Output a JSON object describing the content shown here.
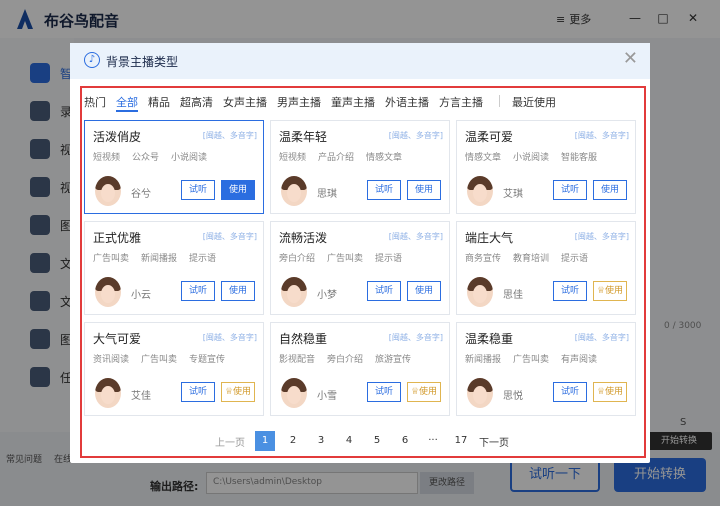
{
  "app": {
    "name": "布谷鸟配音",
    "more_label": "更多",
    "window_controls": [
      "—",
      "□",
      "✕"
    ],
    "sidebar_labels": [
      "智",
      "录",
      "视",
      "视",
      "图",
      "文",
      "文",
      "图",
      "任"
    ],
    "bottom_items": [
      "常见问题",
      "在线客服",
      "进入官网"
    ],
    "output_label": "输出路径:",
    "output_path": "C:\\Users\\admin\\Desktop",
    "change_path_label": "更改路径",
    "listen_button": "试听一下",
    "start_button": "开始转换",
    "tooltip": "开始转换",
    "counter": "0 / 3000",
    "side_partial_right": "S"
  },
  "modal": {
    "title": "背景主播类型",
    "tabs": [
      "热门",
      "全部",
      "精品",
      "超高清",
      "女声主播",
      "男声主播",
      "童声主播",
      "外语主播",
      "方言主播"
    ],
    "tabs_extra": "最近使用",
    "active_tab": "全部",
    "cards": [
      {
        "name": "活泼俏皮",
        "tag": "[闽越、多音字]",
        "desc": [
          "短视频",
          "公众号",
          "小说阅读"
        ],
        "person": "谷兮",
        "listen": "试听",
        "use": "使用",
        "use_style": "primary",
        "selected": true
      },
      {
        "name": "温柔年轻",
        "tag": "[闽越、多音字]",
        "desc": [
          "短视频",
          "产品介绍",
          "情感文章"
        ],
        "person": "思琪",
        "listen": "试听",
        "use": "使用",
        "use_style": "normal",
        "selected": false
      },
      {
        "name": "温柔可爱",
        "tag": "[闽越、多音字]",
        "desc": [
          "情感文章",
          "小说阅读",
          "智能客服"
        ],
        "person": "艾琪",
        "listen": "试听",
        "use": "使用",
        "use_style": "normal",
        "selected": false
      },
      {
        "name": "正式优雅",
        "tag": "[闽越、多音字]",
        "desc": [
          "广告叫卖",
          "新闻播报",
          "提示语"
        ],
        "person": "小云",
        "listen": "试听",
        "use": "使用",
        "use_style": "normal",
        "selected": false
      },
      {
        "name": "流畅活泼",
        "tag": "[闽越、多音字]",
        "desc": [
          "旁白介绍",
          "广告叫卖",
          "提示语"
        ],
        "person": "小梦",
        "listen": "试听",
        "use": "使用",
        "use_style": "normal",
        "selected": false
      },
      {
        "name": "端庄大气",
        "tag": "[闽越、多音字]",
        "desc": [
          "商务宣传",
          "教育培训",
          "提示语"
        ],
        "person": "思佳",
        "listen": "试听",
        "use": "使用",
        "use_style": "vip",
        "selected": false
      },
      {
        "name": "大气可爱",
        "tag": "[闽越、多音字]",
        "desc": [
          "资讯阅读",
          "广告叫卖",
          "专题宣传"
        ],
        "person": "艾佳",
        "listen": "试听",
        "use": "使用",
        "use_style": "vip",
        "selected": false
      },
      {
        "name": "自然稳重",
        "tag": "[闽越、多音字]",
        "desc": [
          "影视配音",
          "旁白介绍",
          "旅游宣传"
        ],
        "person": "小雪",
        "listen": "试听",
        "use": "使用",
        "use_style": "vip",
        "selected": false
      },
      {
        "name": "温柔稳重",
        "tag": "[闽越、多音字]",
        "desc": [
          "新闻播报",
          "广告叫卖",
          "有声阅读"
        ],
        "person": "思悦",
        "listen": "试听",
        "use": "使用",
        "use_style": "vip",
        "selected": false
      }
    ],
    "pager": {
      "prev": "上一页",
      "pages": [
        "1",
        "2",
        "3",
        "4",
        "5",
        "6",
        "···",
        "17"
      ],
      "active": "1",
      "next": "下一页"
    }
  }
}
